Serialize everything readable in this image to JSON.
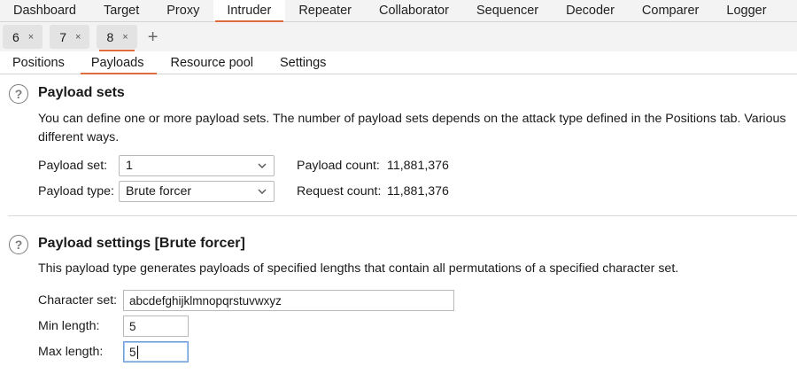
{
  "top_tabs": [
    "Dashboard",
    "Target",
    "Proxy",
    "Intruder",
    "Repeater",
    "Collaborator",
    "Sequencer",
    "Decoder",
    "Comparer",
    "Logger"
  ],
  "top_tab_active": "Intruder",
  "instance_tabs": [
    "6",
    "7",
    "8"
  ],
  "instance_close_glyph": "×",
  "instance_add_glyph": "+",
  "sub_tabs": [
    "Positions",
    "Payloads",
    "Resource pool",
    "Settings"
  ],
  "payload_sets": {
    "title": "Payload sets",
    "description": "You can define one or more payload sets. The number of payload sets depends on the attack type defined in the Positions tab. Various different ways.",
    "set_label": "Payload set:",
    "set_value": "1",
    "type_label": "Payload type:",
    "type_value": "Brute forcer",
    "payload_count_label": "Payload count:",
    "payload_count": "11,881,376",
    "request_count_label": "Request count:",
    "request_count": "11,881,376"
  },
  "payload_settings": {
    "title": "Payload settings [Brute forcer]",
    "description": "This payload type generates payloads of specified lengths that contain all permutations of a specified character set.",
    "charset_label": "Character set:",
    "charset_value": "abcdefghijklmnopqrstuvwxyz",
    "min_label": "Min length:",
    "min_value": "5",
    "max_label": "Max length:",
    "max_value": "5"
  },
  "help_glyph": "?",
  "colors": {
    "accent": "#e06b3c",
    "focus": "#6e9ed6"
  }
}
